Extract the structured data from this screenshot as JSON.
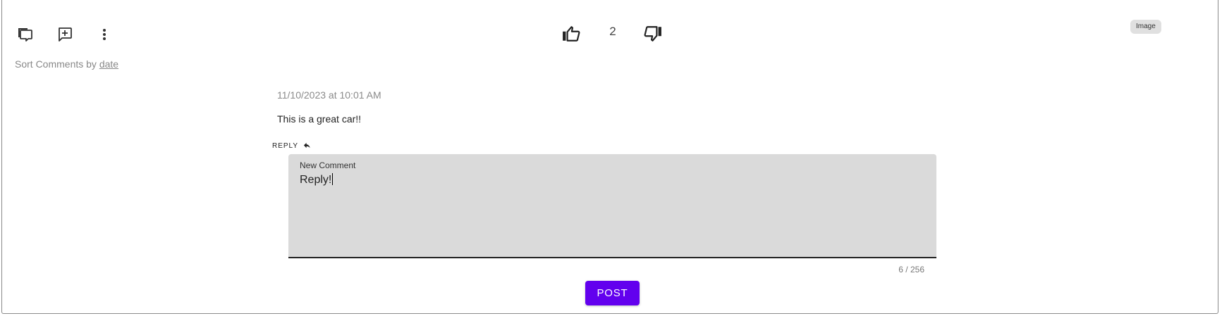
{
  "toolbar": {
    "comments_icon": "comments-icon",
    "add_comment_icon": "add-comment-icon",
    "more_icon": "more-vertical-icon",
    "like_icon": "thumb-up-icon",
    "like_count": "2",
    "dislike_icon": "thumb-down-icon",
    "tag_label": "Image"
  },
  "sort": {
    "prefix": "Sort Comments by",
    "value": "date"
  },
  "comment": {
    "date": "11/10/2023 at 10:01 AM",
    "text": "This is a great car!!",
    "reply_label": "REPLY",
    "reply_icon": "reply-icon"
  },
  "new_comment": {
    "label": "New Comment",
    "value": "Reply!",
    "counter": "6 / 256",
    "post_label": "POST"
  },
  "colors": {
    "accent": "#6200ee",
    "field_bg": "#dadada",
    "chip_bg": "#e0e0e0"
  }
}
